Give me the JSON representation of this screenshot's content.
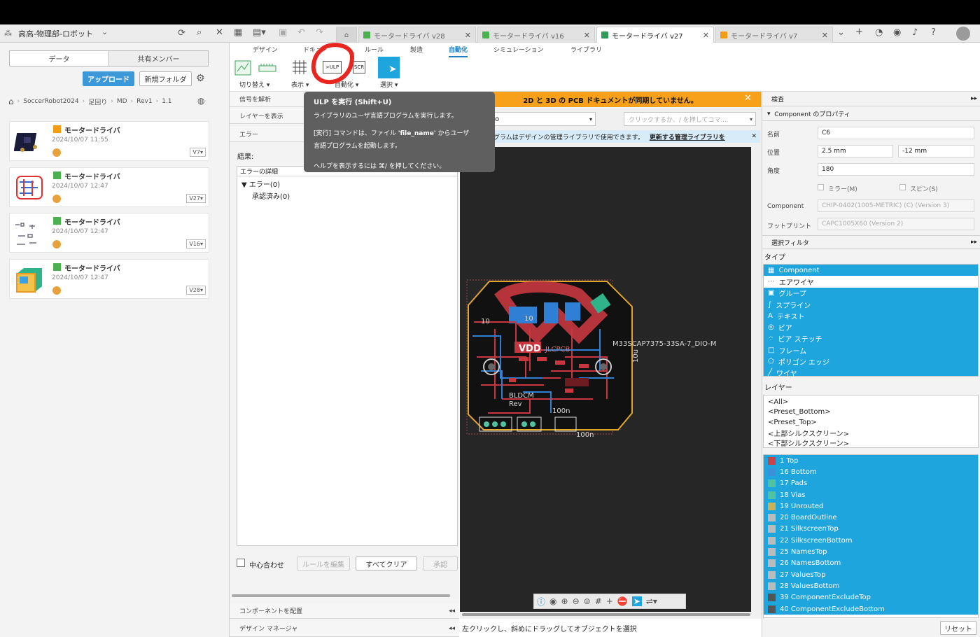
{
  "app": {
    "project": "高高-物理部-ロボット",
    "tabs": [
      {
        "label": "モータードライバ v28",
        "color": "#4caf50"
      },
      {
        "label": "モータードライバ v16",
        "color": "#4caf50"
      },
      {
        "label": "モータードライバ v27",
        "color": "#4caf50"
      },
      {
        "label": "モータードライバ v7",
        "color": "#f39c12"
      }
    ]
  },
  "left": {
    "segments": [
      "データ",
      "共有メンバー"
    ],
    "upload": "アップロード",
    "new_folder": "新規フォルダ",
    "breadcrumb": [
      "SoccerRobot2024",
      "足回り",
      "MD",
      "Rev1",
      "1.1"
    ],
    "items": [
      {
        "title": "モータードライバ",
        "date": "2024/10/07 11:55",
        "version": "V7"
      },
      {
        "title": "モータードライバ",
        "date": "2024/10/07 12:47",
        "version": "V27"
      },
      {
        "title": "モータードライバ",
        "date": "2024/10/07 12:47",
        "version": "V16"
      },
      {
        "title": "モータードライバ",
        "date": "2024/10/07 12:47",
        "version": "V28"
      }
    ]
  },
  "ribbon": {
    "tabs": [
      "デザイン",
      "ドキュ",
      "ルール",
      "製造",
      "自動化",
      "シミュレーション",
      "ライブラリ"
    ],
    "groups": [
      "切り替え",
      "表示",
      "自動化",
      "選択"
    ],
    "ulp_label": ">ULP",
    "scr_label": "SCR"
  },
  "mid": {
    "sections": [
      "信号を解析",
      "レイヤーを表示",
      "エラー"
    ],
    "results_label": "結果:",
    "col_header": "エラーの詳細",
    "tree": [
      "エラー(0)",
      "承認済み(0)"
    ],
    "center_label": "中心合わせ",
    "edit_rules": "ルールを編集",
    "clear_all": "すべてクリア",
    "approve": "承認",
    "bottom_sections": [
      "コンポーネントを配置",
      "デザイン マネージャ"
    ]
  },
  "canvas": {
    "banner": "2D と 3D の PCB ドキュメントが同期していません。",
    "dropdown_value": "o",
    "command_placeholder": "クリックするか、/ を押してコマ...",
    "info_text": "グラムはデザインの管理ライブラリで使用できます。",
    "info_link": "更新する管理ライブラリを",
    "labels": [
      "M33SCAP7375-33SA-7_DIO-M",
      "BLDCM",
      "Rev",
      "VDD",
      "JLCPCB",
      "100n",
      "100n",
      "10",
      "10",
      "10u"
    ],
    "status": "左クリックし、斜めにドラッグしてオブジェクトを選択"
  },
  "tooltip": {
    "title": "ULP を実行 (Shift+U)",
    "line1": "ライブラリのユーザ言語プログラムを実行します。",
    "line2a": "[実行] コマンドは、ファイル ",
    "line2b": "'file_name'",
    "line2c": " からユーザ",
    "line3": "言語プログラムを起動します。",
    "line4": "ヘルプを表示するには ⌘/ を押してください。"
  },
  "right": {
    "inspect": "検査",
    "props_title": "Component のプロパティ",
    "props": {
      "name_label": "名前",
      "name": "C6",
      "pos_label": "位置",
      "x": "2.5 mm",
      "y": "-12 mm",
      "angle_label": "角度",
      "angle": "180",
      "mirror": "ミラー(M)",
      "spin": "スピン(S)",
      "component_label": "Component",
      "component": "CHIP-0402(1005-METRIC) (C) (Version 3)",
      "footprint_label": "フットプリント",
      "footprint": "CAPC1005X60 (Version 2)"
    },
    "filter_title": "選択フィルタ",
    "type_label": "タイプ",
    "types": [
      {
        "label": "Component",
        "sel": true
      },
      {
        "label": "エアワイヤ",
        "sel": false
      },
      {
        "label": "グループ",
        "sel": true
      },
      {
        "label": "スプライン",
        "sel": true
      },
      {
        "label": "テキスト",
        "sel": true
      },
      {
        "label": "ビア",
        "sel": true
      },
      {
        "label": "ビア ステッチ",
        "sel": true
      },
      {
        "label": "フレーム",
        "sel": true
      },
      {
        "label": "ポリゴン エッジ",
        "sel": true
      },
      {
        "label": "ワイヤ",
        "sel": true
      }
    ],
    "layer_label": "レイヤー",
    "presets": [
      "<All>",
      "<Preset_Bottom>",
      "<Preset_Top>",
      "<上部シルクスクリーン>",
      "<下部シルクスクリーン>"
    ],
    "layers": [
      {
        "label": "1 Top",
        "color": "#c8434a"
      },
      {
        "label": "16 Bottom",
        "color": "#3d8fd6"
      },
      {
        "label": "17 Pads",
        "color": "#4fc3a1"
      },
      {
        "label": "18 Vias",
        "color": "#4fc3a1"
      },
      {
        "label": "19 Unrouted",
        "color": "#c9b35a"
      },
      {
        "label": "20 BoardOutline",
        "color": "#bbbbbb"
      },
      {
        "label": "21 SilkscreenTop",
        "color": "#bbbbbb"
      },
      {
        "label": "22 SilkscreenBottom",
        "color": "#bbbbbb"
      },
      {
        "label": "25 NamesTop",
        "color": "#bbbbbb"
      },
      {
        "label": "26 NamesBottom",
        "color": "#bbbbbb"
      },
      {
        "label": "27 ValuesTop",
        "color": "#bbbbbb"
      },
      {
        "label": "28 ValuesBottom",
        "color": "#bbbbbb"
      },
      {
        "label": "39 ComponentExcludeTop",
        "color": "#555555"
      },
      {
        "label": "40 ComponentExcludeBottom",
        "color": "#555555"
      }
    ],
    "reset": "リセット"
  }
}
